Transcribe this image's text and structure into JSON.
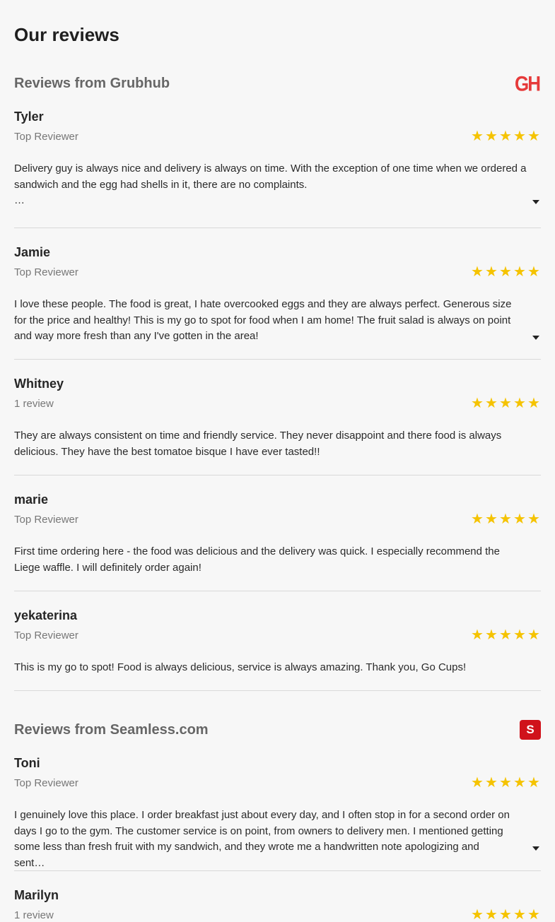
{
  "page_title": "Our reviews",
  "sections": [
    {
      "title": "Reviews from Grubhub",
      "logo_text": "GH",
      "logo_color": "#e63a3a",
      "reviews": [
        {
          "name": "Tyler",
          "tag": "Top Reviewer",
          "rating": 5,
          "text": "Delivery guy is always nice and delivery is always on time. With the exception of one time when we ordered a sandwich and the egg had shells in it, there are no complaints.",
          "ellipsis": "…",
          "expandable": true
        },
        {
          "name": "Jamie",
          "tag": "Top Reviewer",
          "rating": 5,
          "text": "I love these people. The food is great, I hate overcooked eggs and they are always perfect. Generous size for the price and healthy! This is my go to spot for food when I am home! The fruit salad is always on point and way more fresh than any I've gotten in the area!",
          "expandable": true
        },
        {
          "name": "Whitney",
          "tag": "1 review",
          "rating": 5,
          "text": "They are always consistent on time and friendly service. They never disappoint and there food is always delicious. They have the best tomatoe bisque I have ever tasted!!",
          "expandable": false
        },
        {
          "name": "marie",
          "tag": "Top Reviewer",
          "rating": 5,
          "text": "First time ordering here - the food was delicious and the delivery was quick. I especially recommend the Liege waffle. I will definitely order again!",
          "expandable": false
        },
        {
          "name": "yekaterina",
          "tag": "Top Reviewer",
          "rating": 5,
          "text": "This is my go to spot! Food is always delicious, service is always amazing. Thank you, Go Cups!",
          "expandable": false
        }
      ]
    },
    {
      "title": "Reviews from Seamless.com",
      "logo_text": "S",
      "logo_color": "#d0121b",
      "reviews": [
        {
          "name": "Toni",
          "tag": "Top Reviewer",
          "rating": 5,
          "text": "I genuinely love this place. I order breakfast just about every day, and I often stop in for a second order on days I go to the gym. The customer service is on point, from owners to delivery men. I mentioned getting some less than fresh fruit with my sandwich, and they wrote me a handwritten note apologizing and sent…",
          "expandable": true
        },
        {
          "name": "Marilyn",
          "tag": "1 review",
          "rating": 5,
          "text": "",
          "expandable": false
        }
      ]
    }
  ],
  "colors": {
    "star": "#f5c300",
    "divider": "#d9d9d9"
  },
  "icons": {
    "star": "star-icon",
    "expand": "caret-down-icon"
  }
}
